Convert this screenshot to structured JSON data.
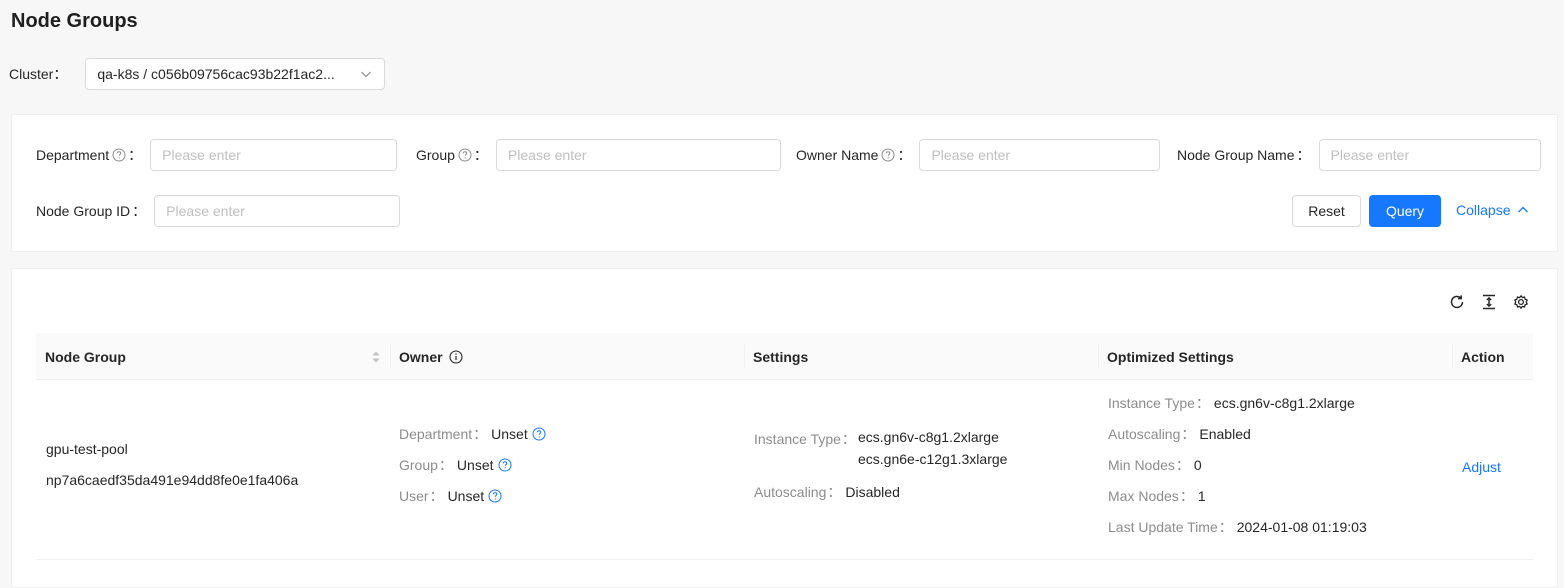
{
  "page": {
    "title": "Node Groups"
  },
  "cluster": {
    "label": "Cluster",
    "colon": "：",
    "value": "qa-k8s / c056b09756cac93b22f1ac2..."
  },
  "filters": {
    "department": {
      "label": "Department",
      "placeholder": "Please enter"
    },
    "group": {
      "label": "Group",
      "placeholder": "Please enter"
    },
    "owner_name": {
      "label": "Owner Name",
      "placeholder": "Please enter"
    },
    "node_group_name": {
      "label": "Node Group Name",
      "placeholder": "Please enter"
    },
    "node_group_id": {
      "label": "Node Group ID",
      "placeholder": "Please enter"
    },
    "colon": "：",
    "reset_label": "Reset",
    "query_label": "Query",
    "collapse_label": "Collapse"
  },
  "toolbar": {
    "icons": [
      "reload-icon",
      "column-height-icon",
      "setting-icon"
    ]
  },
  "table": {
    "columns": [
      {
        "label": "Node Group"
      },
      {
        "label": "Owner"
      },
      {
        "label": "Settings"
      },
      {
        "label": "Optimized Settings"
      },
      {
        "label": "Action"
      }
    ],
    "rows": [
      {
        "node_group_name": "gpu-test-pool",
        "node_group_id": "np7a6caedf35da491e94dd8fe0e1fa406a",
        "owner": {
          "department": {
            "key": "Department",
            "value": "Unset"
          },
          "group": {
            "key": "Group",
            "value": "Unset"
          },
          "user": {
            "key": "User",
            "value": "Unset"
          }
        },
        "settings": {
          "instance_type": {
            "key": "Instance Type",
            "values": [
              "ecs.gn6v-c8g1.2xlarge",
              "ecs.gn6e-c12g1.3xlarge"
            ]
          },
          "autoscaling": {
            "key": "Autoscaling",
            "value": "Disabled"
          }
        },
        "optimized": {
          "instance_type": {
            "key": "Instance Type",
            "value": "ecs.gn6v-c8g1.2xlarge"
          },
          "autoscaling": {
            "key": "Autoscaling",
            "value": "Enabled"
          },
          "min_nodes": {
            "key": "Min Nodes",
            "value": "0"
          },
          "max_nodes": {
            "key": "Max Nodes",
            "value": "1"
          },
          "last_update": {
            "key": "Last Update Time",
            "value": "2024-01-08 01:19:03"
          }
        },
        "action_label": "Adjust"
      }
    ],
    "kv_sep": "："
  },
  "colors": {
    "primary": "#1677ff",
    "border": "#d9d9d9",
    "muted": "#8c8c8c"
  }
}
